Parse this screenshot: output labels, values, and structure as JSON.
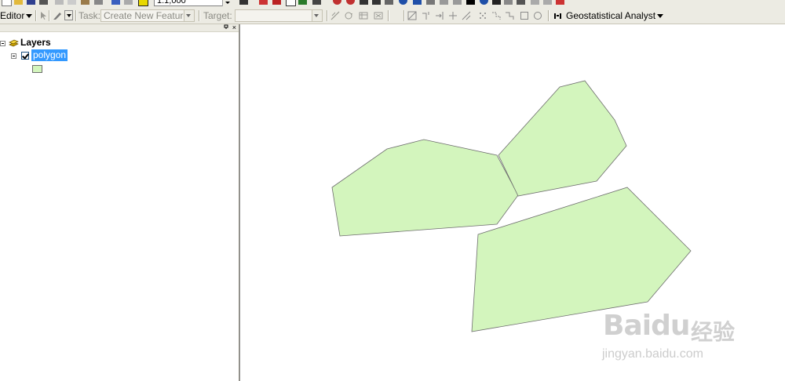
{
  "toolbar_top": {
    "scale_value": "1:1,000"
  },
  "editor_toolbar": {
    "editor_label": "Editor",
    "task_label": "Task:",
    "task_value": "Create New Feature",
    "target_label": "Target:",
    "target_value": "",
    "geostat_label": "Geostatistical Analyst"
  },
  "toc": {
    "root_label": "Layers",
    "layers": [
      {
        "name": "polygon",
        "checked": true,
        "fill_color": "#d3f5bd"
      }
    ]
  },
  "map": {
    "polygon_fill": "#d3f5bd",
    "polygon_stroke": "#6e6e6e"
  },
  "watermark": {
    "logo": "Baidu",
    "cn": "经验",
    "url": "jingyan.baidu.com"
  }
}
